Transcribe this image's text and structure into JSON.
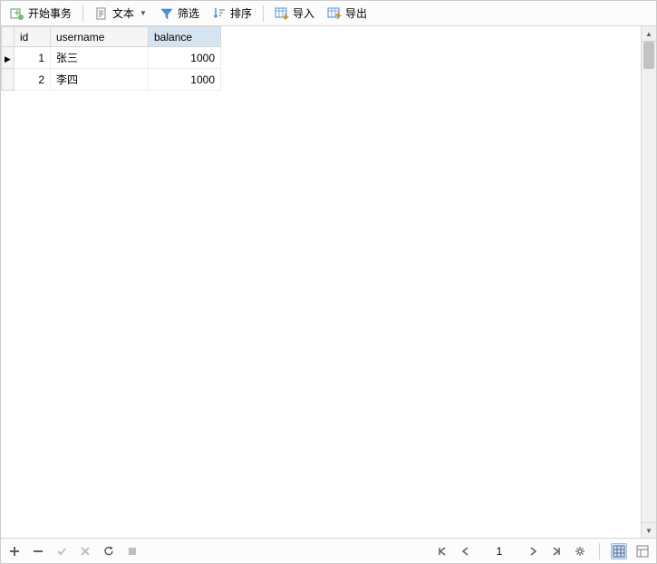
{
  "toolbar": {
    "begin_transaction": "开始事务",
    "text": "文本",
    "filter": "筛选",
    "sort": "排序",
    "import": "导入",
    "export": "导出"
  },
  "table": {
    "columns": [
      "id",
      "username",
      "balance"
    ],
    "sorted_column": "balance",
    "rows": [
      {
        "id": "1",
        "username": "张三",
        "balance": "1000",
        "current": true
      },
      {
        "id": "2",
        "username": "李四",
        "balance": "1000",
        "current": false
      }
    ]
  },
  "pager": {
    "page": "1"
  }
}
